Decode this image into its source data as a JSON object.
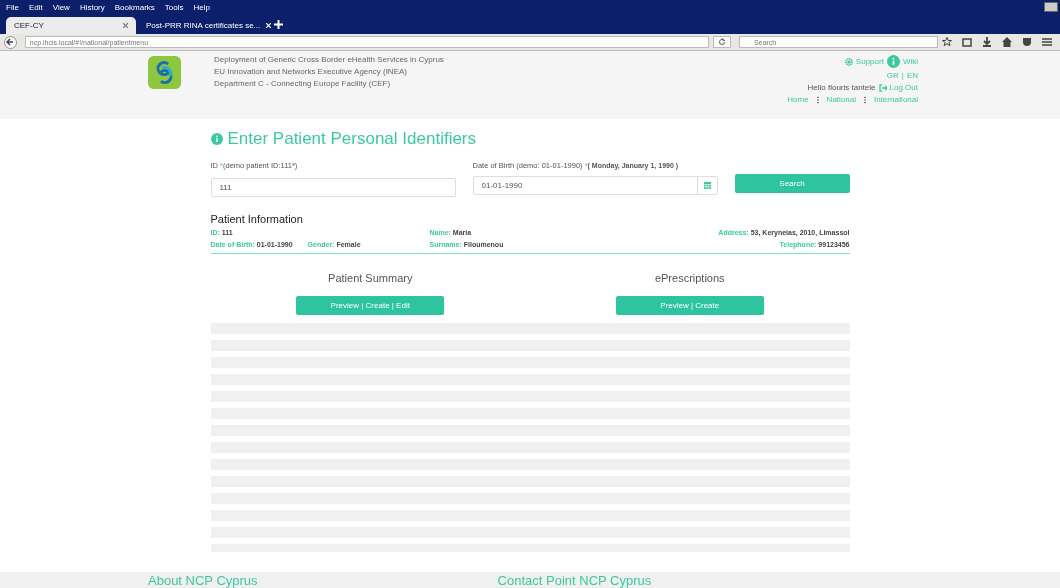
{
  "browser": {
    "menu": [
      "File",
      "Edit",
      "View",
      "History",
      "Bookmarks",
      "Tools",
      "Help"
    ],
    "tabs": [
      {
        "label": "CEF-CY",
        "selected": true
      },
      {
        "label": "Post-PRR RINA certificates se...",
        "selected": false
      }
    ],
    "url": "ncp.ihcis.local/#!/national/patientmenu",
    "search": {
      "placeholder": "Search"
    }
  },
  "header": {
    "lines": [
      "Deployment of Generic Cross Border eHealth Services in Cyprus",
      "EU Innovation and Networks Executive Agency (INEA)",
      "Department C - Connecting Europe Facility (CEF)"
    ],
    "support": "Support",
    "wiki": "Wiki",
    "languages": [
      "GR",
      "EN"
    ],
    "language_separator": "|",
    "greeting": "Hello flouris tantele",
    "logout": "Log Out",
    "nav": [
      "Home",
      "National",
      "International"
    ]
  },
  "title": "Enter Patient Personal Identifiers",
  "form": {
    "id_field": {
      "label": "ID ",
      "required": "*",
      "hint": "(demo patient ID:111*)",
      "value": "111"
    },
    "dob_field": {
      "label": "Date of Birth (demo: 01-01-1990) ",
      "required": "*",
      "note": "( Monday, January 1, 1990 )",
      "value": "01-01-1990"
    },
    "search_button": "Search"
  },
  "patient_info": {
    "heading": "Patient Information",
    "rows": [
      {
        "left": [
          {
            "label": "ID:",
            "value": "111"
          }
        ],
        "middle": [
          {
            "label": "Name:",
            "value": "Maria"
          }
        ],
        "right": [
          {
            "label": "Address:",
            "value": "53, Keryneias, 2010, Limassol"
          }
        ]
      },
      {
        "left": [
          {
            "label": "Date of Birth:",
            "value": "01-01-1990"
          },
          {
            "label": "Gender:",
            "value": "Female"
          }
        ],
        "middle": [
          {
            "label": "Surname:",
            "value": "Filoumenou"
          }
        ],
        "right": [
          {
            "label": "Telephone:",
            "value": "99123456"
          }
        ]
      }
    ]
  },
  "sections": [
    {
      "title": "Patient Summary",
      "button": "Preview | Create | Edit"
    },
    {
      "title": "ePrescriptions",
      "button": "Preview | Create"
    }
  ],
  "footer": [
    "About NCP Cyprus",
    "Contact Point NCP Cyprus"
  ]
}
